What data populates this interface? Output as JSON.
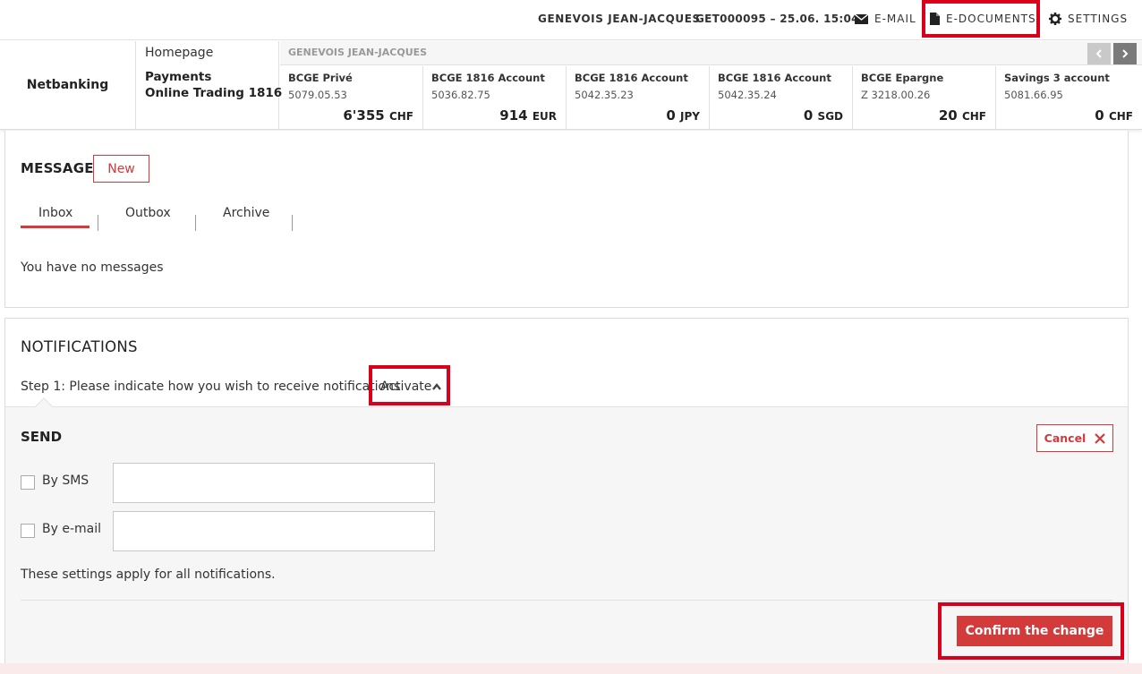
{
  "topbar": {
    "user_name": "GENEVOIS JEAN-JACQUES",
    "contract": "GET000095  – 25.06. 15:04",
    "email_label": "E-MAIL",
    "edocuments_label": "E-DOCUMENTS",
    "settings_label": "SETTINGS"
  },
  "brand": {
    "title": "Netbanking"
  },
  "nav": {
    "home": "Homepage",
    "payments": "Payments",
    "trading": "Online Trading 1816"
  },
  "owner": {
    "name": "GENEVOIS JEAN-JACQUES"
  },
  "accounts": [
    {
      "name": "BCGE Privé",
      "number": "5079.05.53",
      "balance": "6'355",
      "currency": "CHF"
    },
    {
      "name": "BCGE 1816 Account",
      "number": "5036.82.75",
      "balance": "914",
      "currency": "EUR"
    },
    {
      "name": "BCGE 1816 Account",
      "number": "5042.35.23",
      "balance": "0",
      "currency": "JPY"
    },
    {
      "name": "BCGE 1816 Account",
      "number": "5042.35.24",
      "balance": "0",
      "currency": "SGD"
    },
    {
      "name": "BCGE Epargne",
      "number": "Z 3218.00.26",
      "balance": "20",
      "currency": "CHF"
    },
    {
      "name": "Savings 3 account",
      "number": "5081.66.95",
      "balance": "0",
      "currency": "CHF"
    }
  ],
  "message": {
    "title": "MESSAGE",
    "new_label": "New",
    "tabs": {
      "inbox": "Inbox",
      "outbox": "Outbox",
      "archive": "Archive"
    },
    "empty_text": "You have no messages"
  },
  "notifications": {
    "title": "NOTIFICATIONS",
    "step_text": "Step 1: Please indicate how you wish to receive notifications",
    "activate_label": "Activate",
    "send_title": "SEND",
    "cancel_label": "Cancel",
    "sms_label": "By SMS",
    "email_label": "By e-mail",
    "sms_value": "",
    "email_value": "",
    "apply_note": "These settings apply for all notifications.",
    "confirm_label": "Confirm the change"
  },
  "colors": {
    "accent": "#d33a3a",
    "highlight": "#d9001b"
  }
}
